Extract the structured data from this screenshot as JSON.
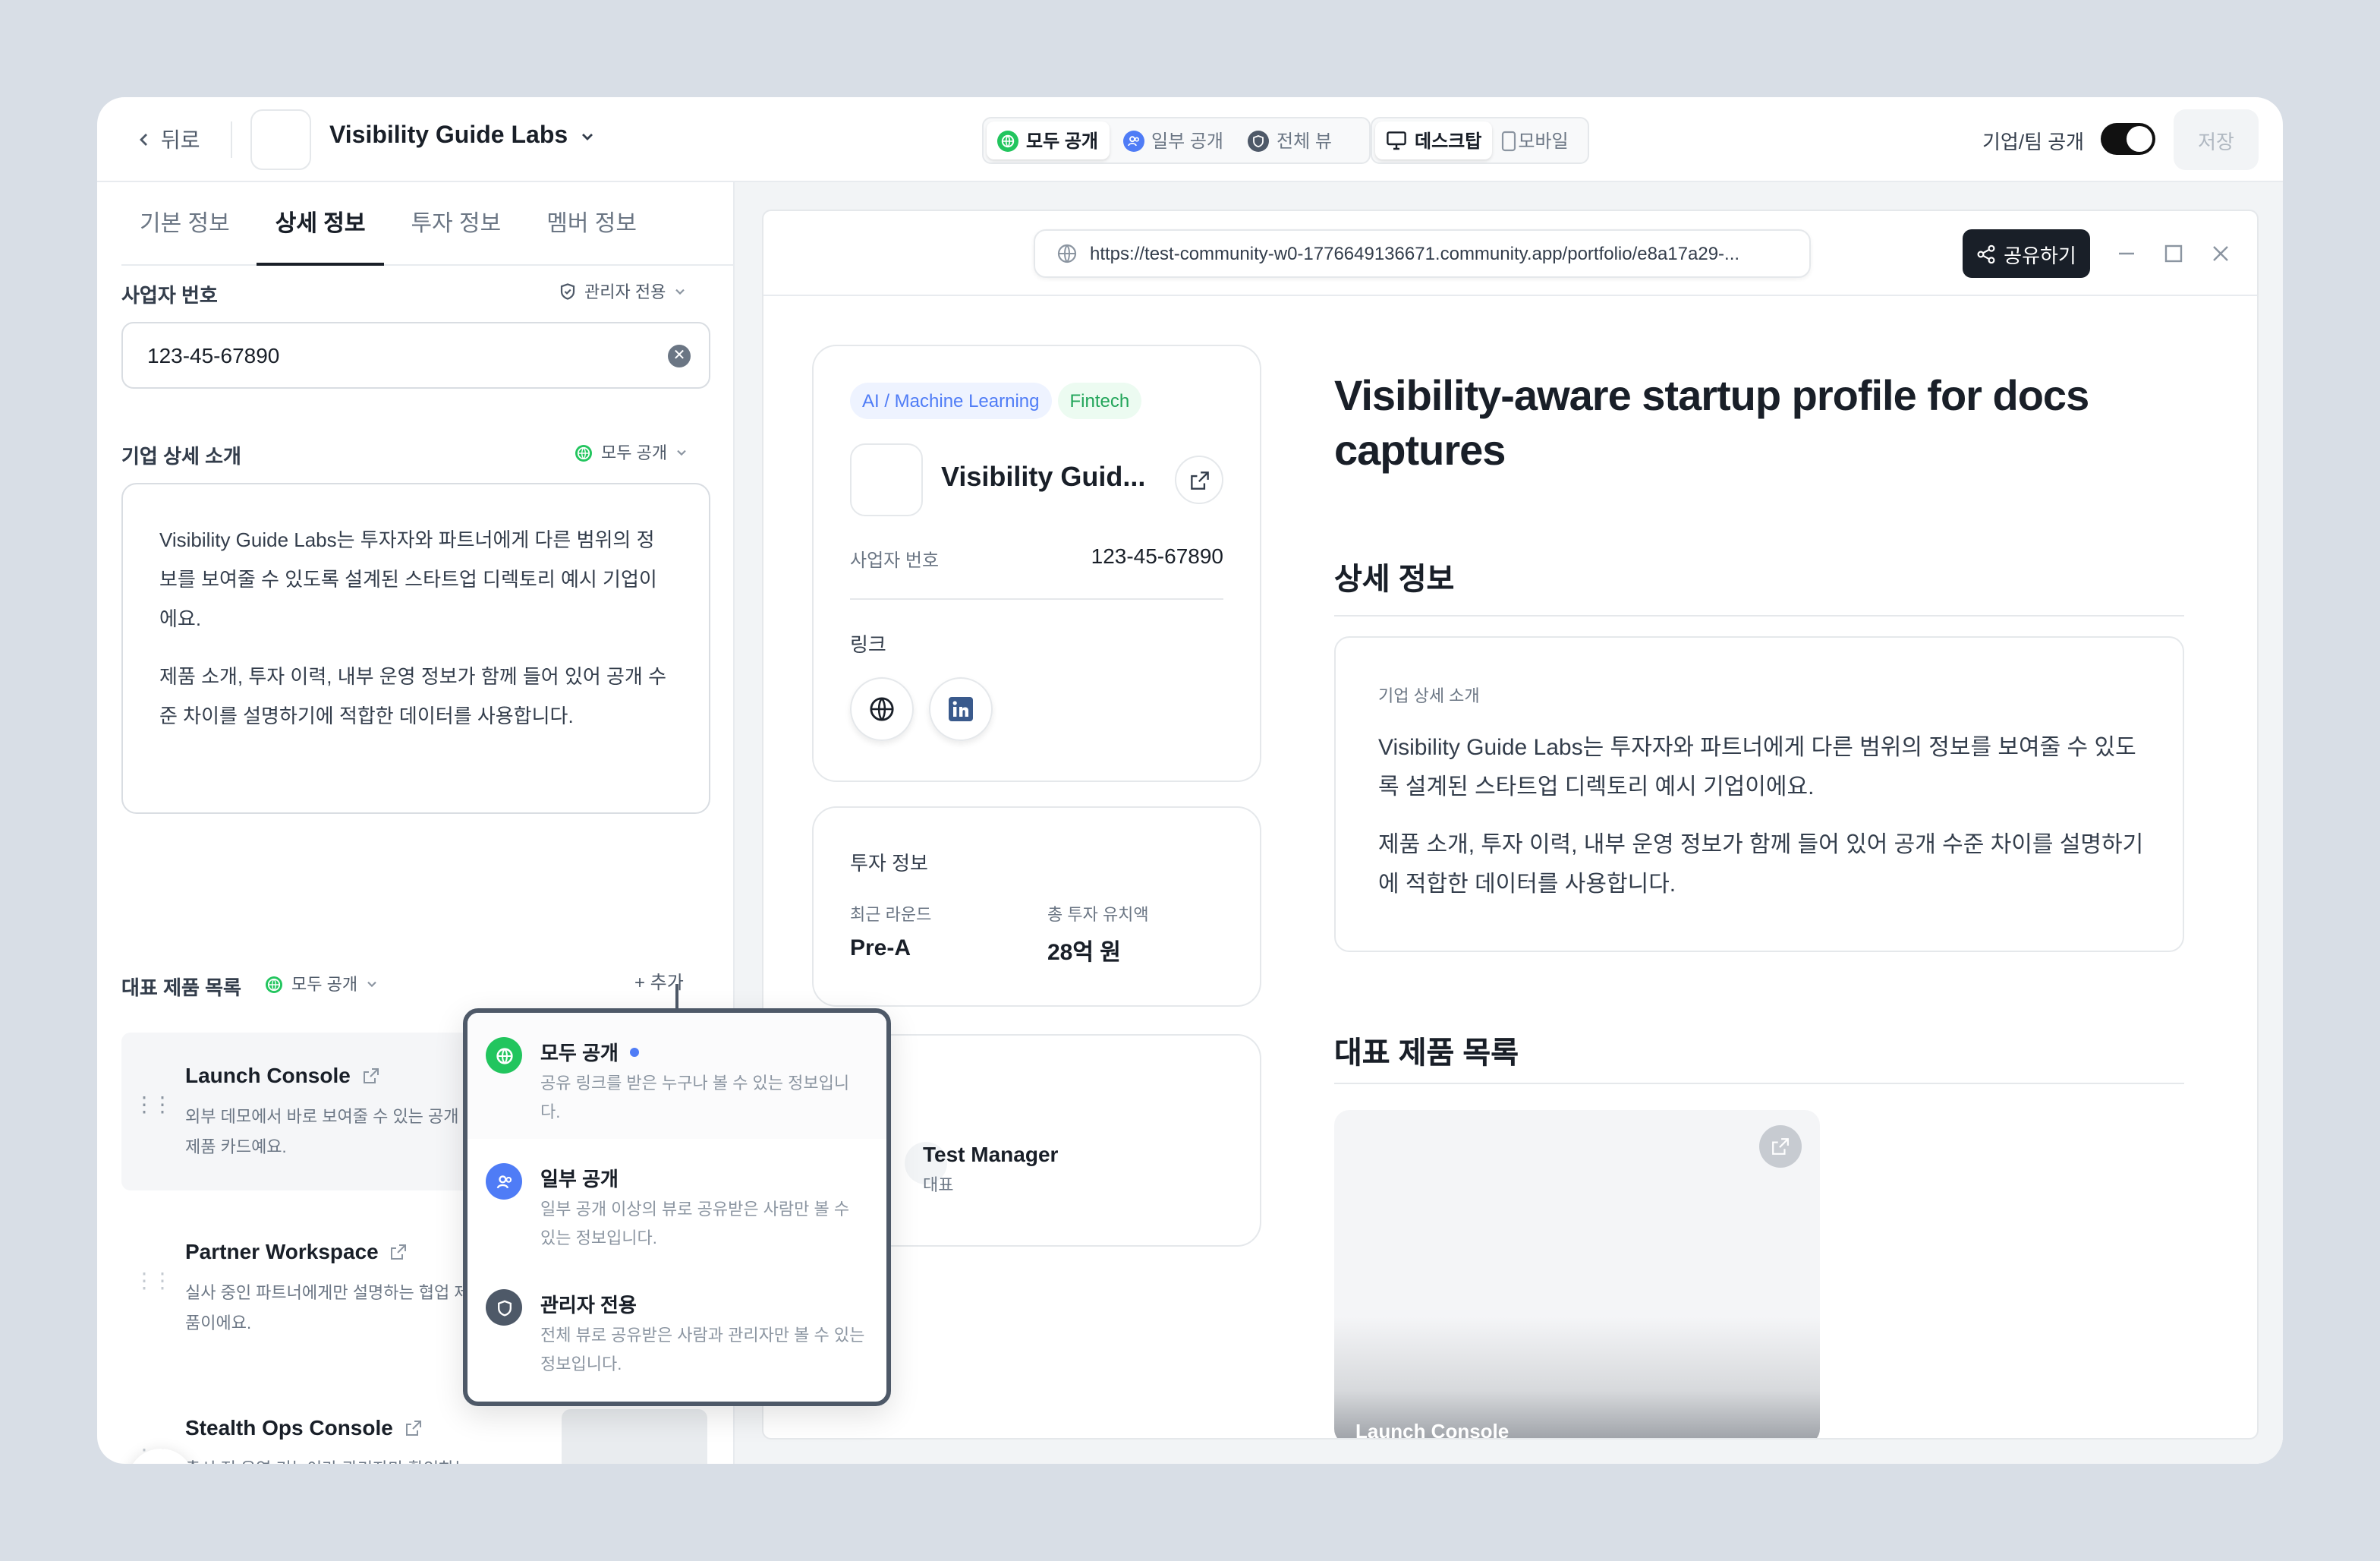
{
  "header": {
    "back_label": "뒤로",
    "company_name": "Visibility Guide Labs",
    "view_modes": [
      "모두 공개",
      "일부 공개",
      "전체 뷰"
    ],
    "devices": [
      "데스크탑",
      "모바일"
    ],
    "public_toggle_label": "기업/팀 공개",
    "public_toggle_on": true,
    "save_label": "저장"
  },
  "tabs": [
    "기본 정보",
    "상세 정보",
    "투자 정보",
    "멤버 정보"
  ],
  "active_tab": "상세 정보",
  "form": {
    "business_number": {
      "label": "사업자 번호",
      "visibility": "관리자 전용",
      "value": "123-45-67890"
    },
    "description": {
      "label": "기업 상세 소개",
      "visibility": "모두 공개",
      "paragraphs": [
        "Visibility Guide Labs는 투자자와 파트너에게 다른 범위의 정보를 보여줄 수 있도록 설계된 스타트업 디렉토리 예시 기업이에요.",
        "제품 소개, 투자 이력, 내부 운영 정보가 함께 들어 있어 공개 수준 차이를 설명하기에 적합한 데이터를 사용합니다."
      ]
    },
    "products": {
      "label": "대표 제품 목록",
      "visibility": "모두 공개",
      "add_label": "+ 추가",
      "items": [
        {
          "title": "Launch Console",
          "desc": "외부 데모에서 바로 보여줄 수 있는 공개 제품 카드예요."
        },
        {
          "title": "Partner Workspace",
          "desc": "실사 중인 파트너에게만 설명하는 협업 제품이에요."
        },
        {
          "title": "Stealth Ops Console",
          "desc": "출시 전 운영 기능이라 관리자만 확인하는 제품 예시예요."
        }
      ]
    }
  },
  "visibility_menu": [
    {
      "title": "모두 공개",
      "desc": "공유 링크를 받은 누구나 볼 수 있는 정보입니다.",
      "selected": true,
      "color": "#22c55e"
    },
    {
      "title": "일부 공개",
      "desc": "일부 공개 이상의 뷰로 공유받은 사람만 볼 수 있는 정보입니다.",
      "selected": false,
      "color": "#4f7cf6"
    },
    {
      "title": "관리자 전용",
      "desc": "전체 뷰로 공유받은 사람과 관리자만 볼 수 있는 정보입니다.",
      "selected": false,
      "color": "#4e5968"
    }
  ],
  "preview": {
    "url": "https://test-community-w0-1776649136671.community.app/portfolio/e8a17a29-...",
    "share_label": "공유하기",
    "profile_card": {
      "tags": [
        "AI / Machine Learning",
        "Fintech"
      ],
      "name": "Visibility Guid...",
      "business_number_label": "사업자 번호",
      "business_number": "123-45-67890",
      "links_label": "링크"
    },
    "investment_card": {
      "title": "투자 정보",
      "recent_round_label": "최근 라운드",
      "recent_round": "Pre-A",
      "total_raised_label": "총 투자 유치액",
      "total_raised": "28억 원"
    },
    "member_card": {
      "name": "Test Manager",
      "role": "대표"
    },
    "headline": "Visibility-aware startup profile for docs captures",
    "detail_section": {
      "title": "상세 정보",
      "box_label": "기업 상세 소개",
      "paragraphs": [
        "Visibility Guide Labs는 투자자와 파트너에게 다른 범위의 정보를 보여줄 수 있도록 설계된 스타트업 디렉토리 예시 기업이에요.",
        "제품 소개, 투자 이력, 내부 운영 정보가 함께 들어 있어 공개 수준 차이를 설명하기에 적합한 데이터를 사용합니다."
      ]
    },
    "products_section": {
      "title": "대표 제품 목록",
      "first_card_title": "Launch Console"
    }
  },
  "colors": {
    "public_green": "#22c55e",
    "partial_blue": "#4f7cf6",
    "admin_gray": "#4e5968",
    "ink": "#191f28"
  }
}
